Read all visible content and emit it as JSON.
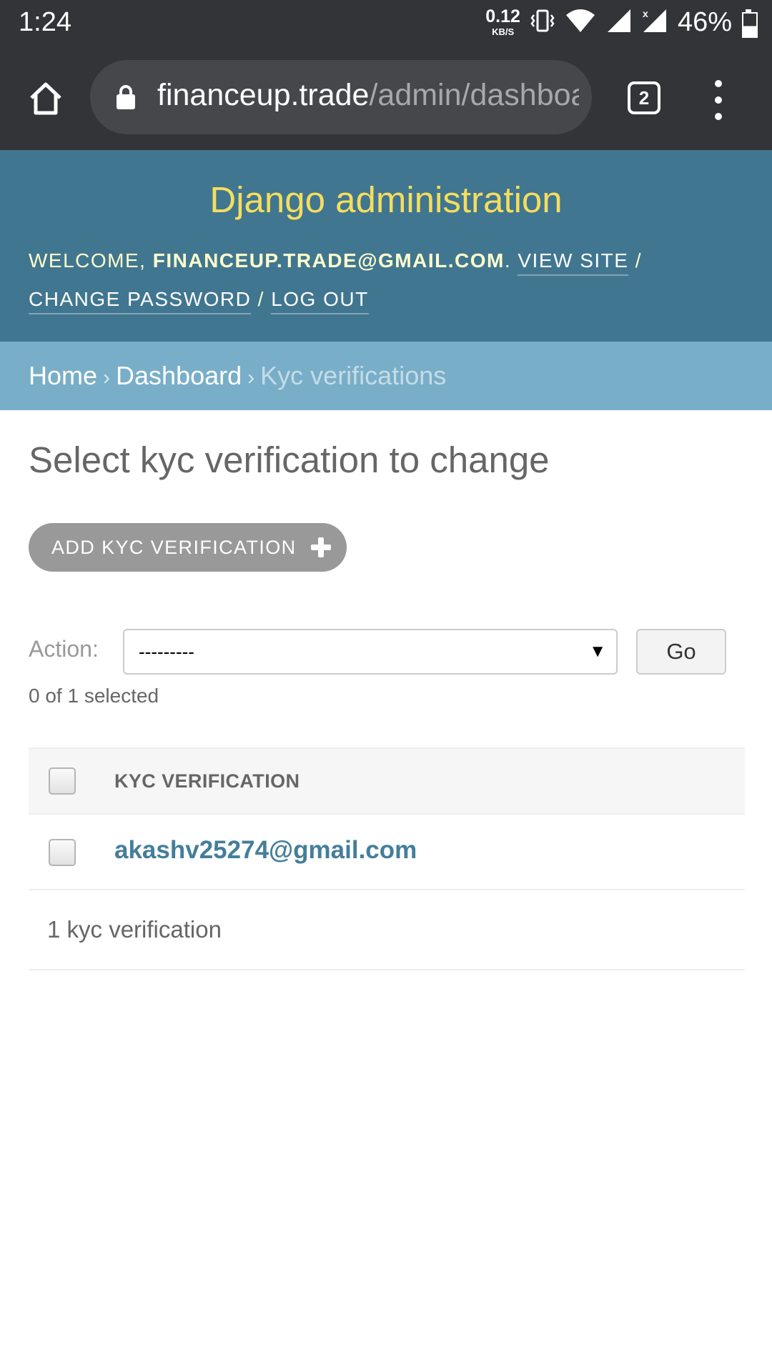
{
  "status_bar": {
    "time": "1:24",
    "net_speed_value": "0.12",
    "net_speed_unit": "KB/S",
    "battery_percent": "46%",
    "icons": [
      "vibrate-icon",
      "wifi-icon",
      "signal-icon",
      "signal-no-data-icon",
      "battery-icon"
    ]
  },
  "browser": {
    "url_host": "financeup.trade",
    "url_path": "/admin/dashboa",
    "tab_count": "2",
    "icons": [
      "home-icon",
      "lock-icon",
      "tabs-icon",
      "overflow-menu-icon"
    ]
  },
  "header": {
    "branding": "Django administration",
    "welcome": "WELCOME,",
    "user_email": "FINANCEUP.TRADE@GMAIL.COM",
    "view_site": "VIEW SITE",
    "change_password": "CHANGE PASSWORD",
    "log_out": "LOG OUT",
    "separator": "/"
  },
  "breadcrumbs": {
    "items": [
      "Home",
      "Dashboard",
      "Kyc verifications"
    ],
    "separator": "›"
  },
  "content": {
    "title": "Select kyc verification to change",
    "add_button": "ADD KYC VERIFICATION",
    "action_label": "Action:",
    "action_selected": "---------",
    "go_button": "Go",
    "selected_count": "0 of 1 selected",
    "column_header": "KYC VERIFICATION",
    "rows": [
      {
        "email": "akashv25274@gmail.com"
      }
    ],
    "paginator": "1 kyc verification"
  },
  "colors": {
    "header_bg": "#417690",
    "branding": "#f5dd5d",
    "breadcrumbs_bg": "#79aec8",
    "link": "#447e9b",
    "browser_bg": "#323437"
  }
}
